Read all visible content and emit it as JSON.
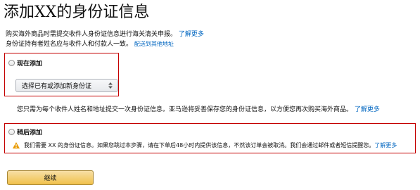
{
  "page": {
    "title": "添加XX的身份证信息"
  },
  "intro": {
    "line1": "购买海外商品时需提交收件人身份证信息进行海关清关申报。",
    "line1_link": "了解更多",
    "line2": "身份证持有者姓名应与收件人和付款人一致。",
    "line2_link": "配送到其他地址"
  },
  "option_now": {
    "label": "现在添加",
    "select_value": "选择已有或添加新身份证"
  },
  "note": {
    "text": "您只需为每个收件人姓名和地址提交一次身份证信息。亚马逊将妥善保存您的身份证信息，以方便您再次购买海外商品。",
    "link": "了解更多"
  },
  "option_later": {
    "label": "稍后添加",
    "warning": "我们需要 XX 的身份证信息。如果您跳过本步骤，请在下单后48小时内提供该信息，不然该订单会被取消。我们会通过邮件或者短信提醒您。",
    "warning_link": "了解更多"
  },
  "continue_button": {
    "label": "继续"
  },
  "colors": {
    "link": "#0066c0",
    "highlight_border": "#c40000",
    "button_top": "#f7dfa5",
    "button_bottom": "#f0c14b",
    "warning_icon": "#e89a00"
  }
}
